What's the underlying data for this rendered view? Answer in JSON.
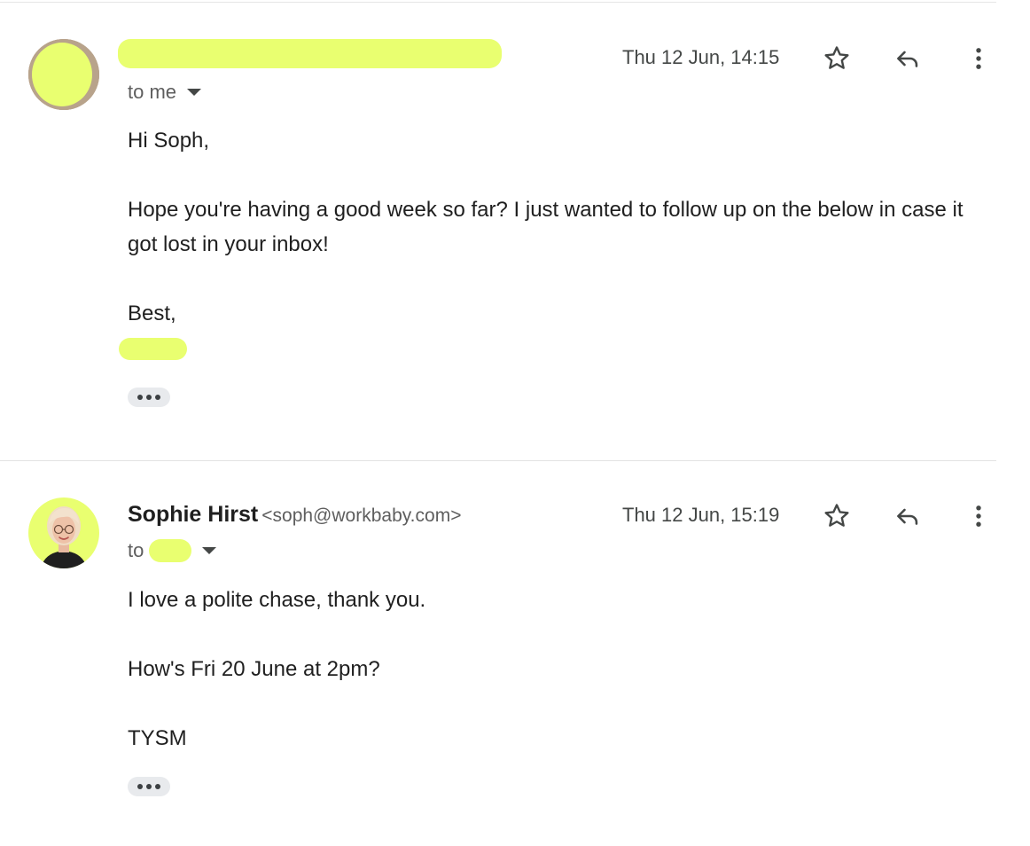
{
  "thread": {
    "messages": [
      {
        "sender_name": "",
        "date": "Thu 12 Jun, 14:15",
        "recipient_prefix": "to me",
        "body": {
          "greeting": "Hi Soph,",
          "paragraph": "Hope you're having a good week so far? I just wanted to follow up on the below in case it got lost in your inbox!",
          "signoff": "Best,"
        }
      },
      {
        "sender_name": "Sophie Hirst",
        "sender_email": "<soph@workbaby.com>",
        "date": "Thu 12 Jun, 15:19",
        "recipient_prefix": "to",
        "body": {
          "line1": "I love a polite chase, thank you.",
          "line2": "How's Fri 20 June at 2pm?",
          "line3": "TYSM"
        }
      }
    ]
  },
  "icons": {
    "star": "star-icon",
    "reply": "reply-icon",
    "more": "more-vert-icon",
    "expand": "chevron-down-icon",
    "trimmed": "ellipsis-icon"
  },
  "colors": {
    "redaction": "#e9ff70",
    "avatar_bg": "#e9ff70",
    "secondary_text": "#5e5e5e",
    "divider": "#e3e3e3"
  }
}
